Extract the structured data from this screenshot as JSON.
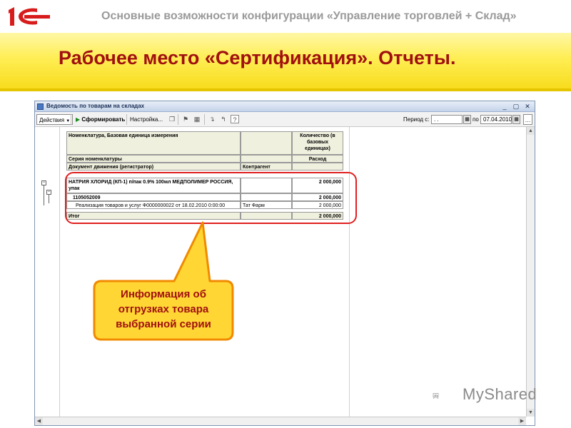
{
  "header": {
    "logo_text": "1С",
    "title": "Основные возможности конфигурации «Управление торговлей + Склад»"
  },
  "slide": {
    "title": "Рабочее место «Сертификация». Отчеты."
  },
  "window": {
    "title": "Ведомость по товарам на складах",
    "controls": [
      "_",
      "▢",
      "✕"
    ]
  },
  "toolbar": {
    "actions_label": "Действия",
    "generate_label": "Сформировать",
    "settings_label": "Настройка...",
    "period_from_label": "Период с:",
    "period_from_value": ". .",
    "period_to_label": "по",
    "period_to_value": "07.04.2010"
  },
  "report": {
    "header": {
      "col1_row1": "Номенклатура, Базовая единица измерения",
      "col3_row1": "Количество (в базовых единицах)",
      "col1_row2": "Серия номенклатуры",
      "col3_row2": "Расход",
      "col1_row3": "Документ движения (регистратор)",
      "col2_row3": "Контрагент"
    },
    "rows": [
      {
        "name": "НАТРИЯ ХЛОРИД (КП-1) п/пак 0.9% 100мл МЕДПОЛИМЕР РОССИЯ, упак",
        "partner": "",
        "qty": "2 000,000"
      },
      {
        "name": "1105052009",
        "partner": "",
        "qty": "2 000,000"
      },
      {
        "name": "Реализация товаров и услуг Ф0000000022 от 18.02.2010 0:00:00",
        "partner": "Тат Фарм",
        "qty": "2 000,000"
      }
    ],
    "total": {
      "label": "Итог",
      "qty": "2 000,000"
    }
  },
  "callout": {
    "text": "Информация об отгрузках товара выбранной серии"
  },
  "watermark": {
    "text": "MyShared"
  },
  "colors": {
    "title_red": "#a01010",
    "band_yellow": "#ffee55",
    "callout_fill": "#ffd633",
    "callout_border": "#f08a00",
    "highlight_red": "#e02020"
  }
}
